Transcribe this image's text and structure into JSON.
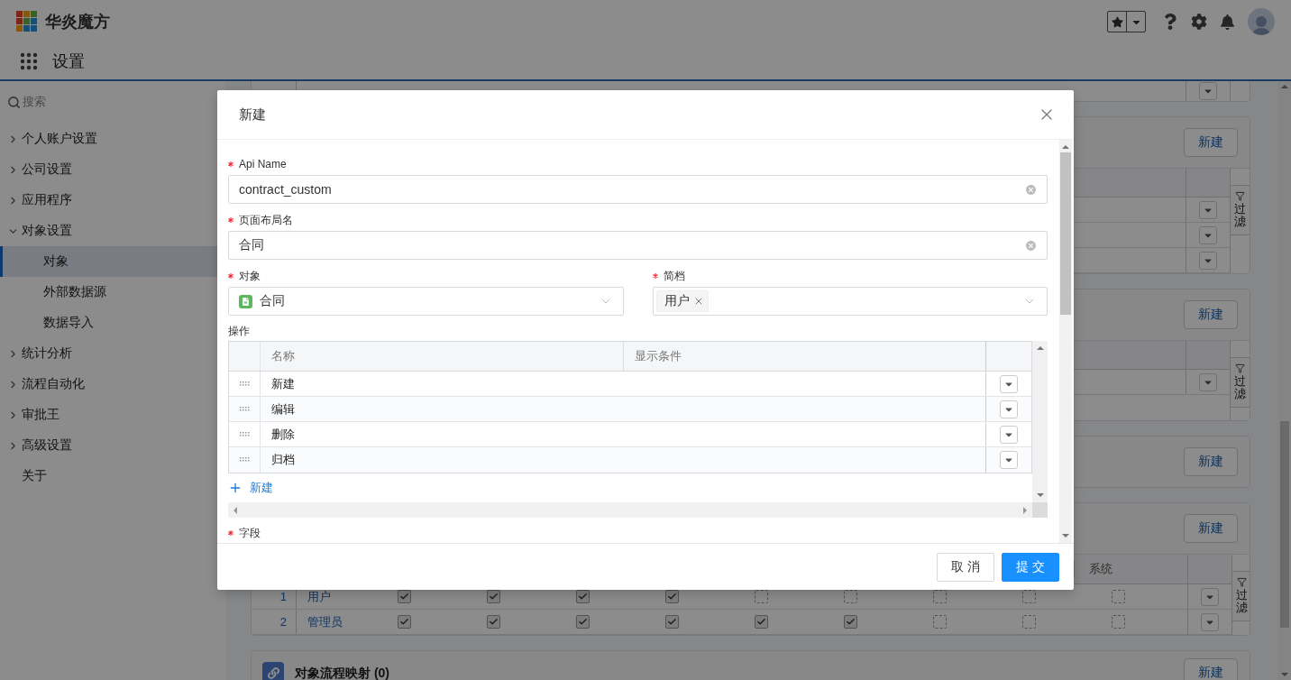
{
  "app": {
    "logo_text": "华炎魔方",
    "nav_title": "设置"
  },
  "sidebar": {
    "search_placeholder": "搜索",
    "items": [
      {
        "label": "个人账户设置",
        "kind": "group",
        "expanded": false,
        "selected": false
      },
      {
        "label": "公司设置",
        "kind": "group",
        "expanded": false,
        "selected": false
      },
      {
        "label": "应用程序",
        "kind": "group",
        "expanded": false,
        "selected": false
      },
      {
        "label": "对象设置",
        "kind": "group",
        "expanded": true,
        "selected": false,
        "children": [
          {
            "label": "对象",
            "selected": true
          },
          {
            "label": "外部数据源",
            "selected": false
          },
          {
            "label": "数据导入",
            "selected": false
          }
        ]
      },
      {
        "label": "统计分析",
        "kind": "group",
        "expanded": false,
        "selected": false
      },
      {
        "label": "流程自动化",
        "kind": "group",
        "expanded": false,
        "selected": false
      },
      {
        "label": "审批王",
        "kind": "group",
        "expanded": false,
        "selected": false
      },
      {
        "label": "高级设置",
        "kind": "group",
        "expanded": false,
        "selected": false
      },
      {
        "label": "关于",
        "kind": "link",
        "selected": false
      }
    ]
  },
  "background": {
    "panels": [
      {
        "button": "新建",
        "filter": "过滤",
        "rows": [
          {
            "menu": true
          },
          {
            "menu": true
          },
          {
            "menu": true
          }
        ]
      },
      {
        "button": "新建",
        "filter": "过滤",
        "rows": [
          {
            "menu": true
          },
          {
            "menu": false
          }
        ]
      },
      {
        "button": "新建"
      },
      {
        "button": "新建",
        "filter": "过滤",
        "last_header": "系统",
        "permission_rows": [
          {
            "index": "1",
            "name": "用户",
            "checks": [
              {
                "checked": true
              },
              {
                "checked": true
              },
              {
                "checked": true
              },
              {
                "checked": true
              },
              {
                "checked": false
              },
              {
                "checked": false
              },
              {
                "checked": false
              },
              {
                "checked": false
              },
              {
                "checked": false
              }
            ]
          },
          {
            "index": "2",
            "name": "管理员",
            "checks": [
              {
                "checked": true
              },
              {
                "checked": true
              },
              {
                "checked": true
              },
              {
                "checked": true
              },
              {
                "checked": true
              },
              {
                "checked": true
              },
              {
                "checked": false
              },
              {
                "checked": false
              },
              {
                "checked": false
              }
            ]
          }
        ]
      },
      {
        "title": "对象流程映射 (0)",
        "button": "新建"
      }
    ]
  },
  "dialog": {
    "title": "新建",
    "fields": [
      {
        "label": "Api Name",
        "required": true,
        "value": "contract_custom"
      },
      {
        "label": "页面布局名",
        "required": true,
        "value": "合同"
      }
    ],
    "selects": [
      {
        "label": "对象",
        "required": true,
        "kind": "object",
        "value": "合同"
      },
      {
        "label": "简档",
        "required": true,
        "kind": "tags",
        "tags": [
          "用户"
        ]
      }
    ],
    "actions": {
      "label": "操作",
      "columns": [
        "名称",
        "显示条件"
      ],
      "rows": [
        {
          "name": "新建"
        },
        {
          "name": "编辑"
        },
        {
          "name": "删除"
        },
        {
          "name": "归档"
        }
      ],
      "add": "新建"
    },
    "next_field": {
      "label": "字段",
      "required": true
    },
    "buttons": [
      {
        "label": "取 消",
        "kind": "default"
      },
      {
        "label": "提 交",
        "kind": "primary"
      }
    ]
  }
}
